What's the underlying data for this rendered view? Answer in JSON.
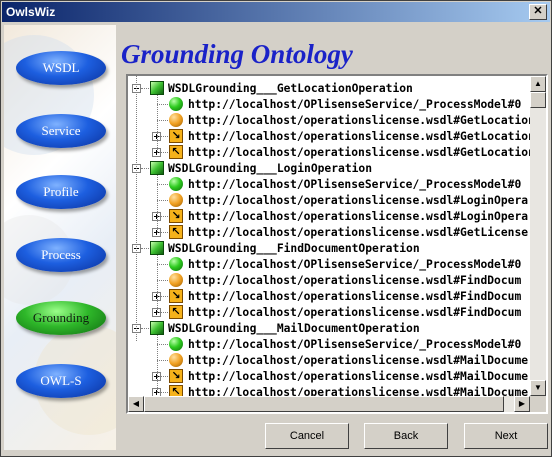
{
  "window": {
    "title": "OwlsWiz",
    "close_glyph": "✕"
  },
  "sidebar": {
    "items": [
      {
        "label": "WSDL",
        "active": false
      },
      {
        "label": "Service",
        "active": false
      },
      {
        "label": "Profile",
        "active": false
      },
      {
        "label": "Process",
        "active": false
      },
      {
        "label": "Grounding",
        "active": true
      },
      {
        "label": "OWL-S",
        "active": false
      }
    ]
  },
  "heading": "Grounding Ontology",
  "tree": {
    "nodes": [
      {
        "kind": "group",
        "icon": "green-cube-icon",
        "label": "WSDLGrounding___GetLocationOperation",
        "children": [
          {
            "icon": "green-ball-icon",
            "expander": false,
            "label": "http://localhost/OPlisenseService/_ProcessModel#0"
          },
          {
            "icon": "orange-ball-icon",
            "expander": false,
            "label": "http://localhost/operationslicense.wsdl#GetLocation"
          },
          {
            "icon": "arrow-in-icon",
            "expander": true,
            "label": "http://localhost/operationslicense.wsdl#GetLocation"
          },
          {
            "icon": "arrow-out-icon",
            "expander": true,
            "label": "http://localhost/operationslicense.wsdl#GetLocation"
          }
        ]
      },
      {
        "kind": "group",
        "icon": "green-cube-icon",
        "label": "WSDLGrounding___LoginOperation",
        "children": [
          {
            "icon": "green-ball-icon",
            "expander": false,
            "label": "http://localhost/OPlisenseService/_ProcessModel#0"
          },
          {
            "icon": "orange-ball-icon",
            "expander": false,
            "label": "http://localhost/operationslicense.wsdl#LoginOpera"
          },
          {
            "icon": "arrow-in-icon",
            "expander": true,
            "label": "http://localhost/operationslicense.wsdl#LoginOpera"
          },
          {
            "icon": "arrow-out-icon",
            "expander": true,
            "label": "http://localhost/operationslicense.wsdl#GetLicense"
          }
        ]
      },
      {
        "kind": "group",
        "icon": "green-cube-icon",
        "label": "WSDLGrounding___FindDocumentOperation",
        "children": [
          {
            "icon": "green-ball-icon",
            "expander": false,
            "label": "http://localhost/OPlisenseService/_ProcessModel#0"
          },
          {
            "icon": "orange-ball-icon",
            "expander": false,
            "label": "http://localhost/operationslicense.wsdl#FindDocum"
          },
          {
            "icon": "arrow-in-icon",
            "expander": true,
            "label": "http://localhost/operationslicense.wsdl#FindDocum"
          },
          {
            "icon": "arrow-out-icon",
            "expander": true,
            "label": "http://localhost/operationslicense.wsdl#FindDocum"
          }
        ]
      },
      {
        "kind": "group",
        "icon": "green-cube-icon",
        "label": "WSDLGrounding___MailDocumentOperation",
        "children": [
          {
            "icon": "green-ball-icon",
            "expander": false,
            "label": "http://localhost/OPlisenseService/_ProcessModel#0"
          },
          {
            "icon": "orange-ball-icon",
            "expander": false,
            "label": "http://localhost/operationslicense.wsdl#MailDocume"
          },
          {
            "icon": "arrow-in-icon",
            "expander": true,
            "label": "http://localhost/operationslicense.wsdl#MailDocume"
          },
          {
            "icon": "arrow-out-icon",
            "expander": true,
            "label": "http://localhost/operationslicense.wsdl#MailDocume"
          }
        ]
      }
    ]
  },
  "footer": {
    "cancel_label": "Cancel",
    "back_label": "Back",
    "next_label": "Next"
  },
  "colors": {
    "heading": "#1a22c8",
    "titlebar_start": "#0a246a",
    "titlebar_end": "#a6caf0",
    "nav_button": "#1d5fe0",
    "nav_active": "#2fb82a"
  }
}
